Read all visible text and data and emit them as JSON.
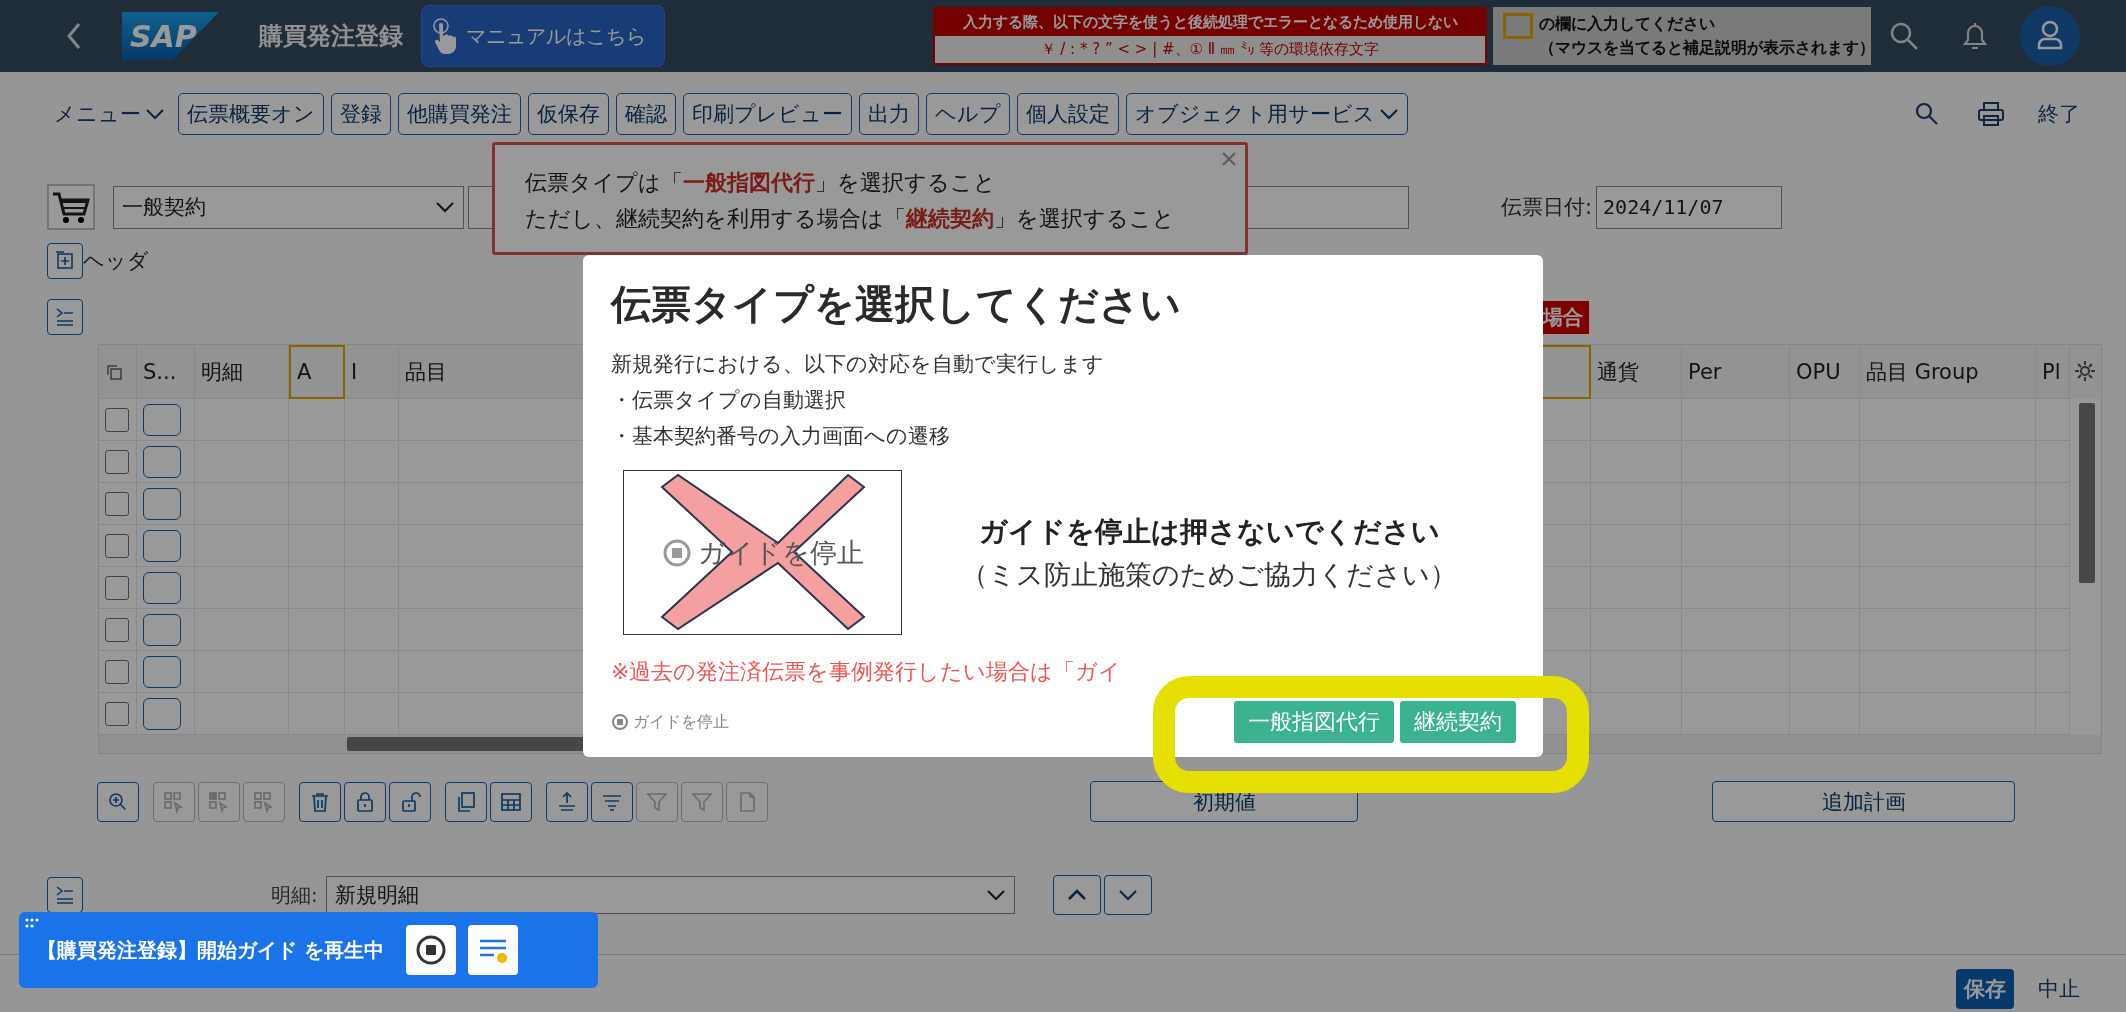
{
  "header": {
    "logo": "SAP",
    "title": "購買発注登録",
    "manual_button": "マニュアルはこちら",
    "warning": {
      "heading": "入力する際、以下の文字を使うと後続処理でエラーとなるため使用しない",
      "characters": "￥ / : * ? ” < > | #、① Ⅱ ㎜ ㍉ 等の環境依存文字"
    },
    "hint": {
      "line1": "の欄に入力してください",
      "line2": "（マウスを当てると補足説明が表示されます）"
    }
  },
  "toolbar": {
    "menu": "メニュー",
    "buttons": [
      "伝票概要オン",
      "登録",
      "他購買発注",
      "仮保存",
      "確認",
      "印刷プレビュー",
      "出力",
      "ヘルプ",
      "個人設定"
    ],
    "services": "オブジェクト用サービス",
    "exit": "終了"
  },
  "document": {
    "type_value": "一般契約",
    "date_label": "伝票日付:",
    "date_value": "2024/11/07",
    "header_label": "ヘッダ",
    "badge": "場合"
  },
  "callout": {
    "lines": [
      "伝票タイプは「**一般指図代行**」を選択すること",
      "ただし、継続契約を利用する場合は「**継続契約**」を選択すること"
    ]
  },
  "table": {
    "columns": [
      {
        "label": "S..."
      },
      {
        "label": "明細"
      },
      {
        "label": "A",
        "highlighted": true
      },
      {
        "label": "I"
      },
      {
        "label": "品目"
      },
      {
        "highlighted": true
      },
      {
        "label": "通貨"
      },
      {
        "label": "Per"
      },
      {
        "label": "OPU"
      },
      {
        "label": "品目 Group"
      },
      {
        "label": "Pl"
      }
    ],
    "rows": [
      {
        "checked": false
      },
      {
        "checked": false
      },
      {
        "checked": false
      },
      {
        "checked": false
      },
      {
        "checked": false
      },
      {
        "checked": false
      },
      {
        "checked": false
      },
      {
        "checked": false
      }
    ]
  },
  "table_tools": [
    [
      {
        "disabled": false
      }
    ],
    [
      {
        "disabled": true
      },
      {
        "disabled": true
      },
      {
        "disabled": true
      }
    ],
    [
      {
        "disabled": false
      },
      {
        "disabled": false
      },
      {
        "disabled": false
      }
    ],
    [
      {
        "disabled": false
      },
      {
        "disabled": false
      }
    ],
    [
      {
        "disabled": false
      },
      {
        "disabled": false
      },
      {
        "disabled": true
      },
      {
        "disabled": true
      },
      {
        "disabled": true
      }
    ]
  ],
  "table_buttons": [
    "初期値",
    "追加計画"
  ],
  "item": {
    "label": "明細:",
    "value": "新規明細"
  },
  "footer": {
    "save": "保存",
    "cancel": "中止"
  },
  "dialog": {
    "title": "伝票タイプを選択してください",
    "intro": "新規発行における、以下の対応を自動で実行します",
    "bullets": [
      "・伝票タイプの自動選択",
      "・基本契約番号の入力画面への遷移"
    ],
    "image_label": "ガイドを停止",
    "warning": "ガイドを停止は押さないでください",
    "warning_sub": "（ミス防止施策のためご協力ください）",
    "note": "※過去の発注済伝票を事例発行したい場合は「ガイ",
    "stop_link": "ガイドを停止",
    "buttons": [
      "一般指図代行",
      "継続契約"
    ]
  },
  "guide_bar": {
    "text": "【購買発注登録】開始ガイド を再生中"
  }
}
